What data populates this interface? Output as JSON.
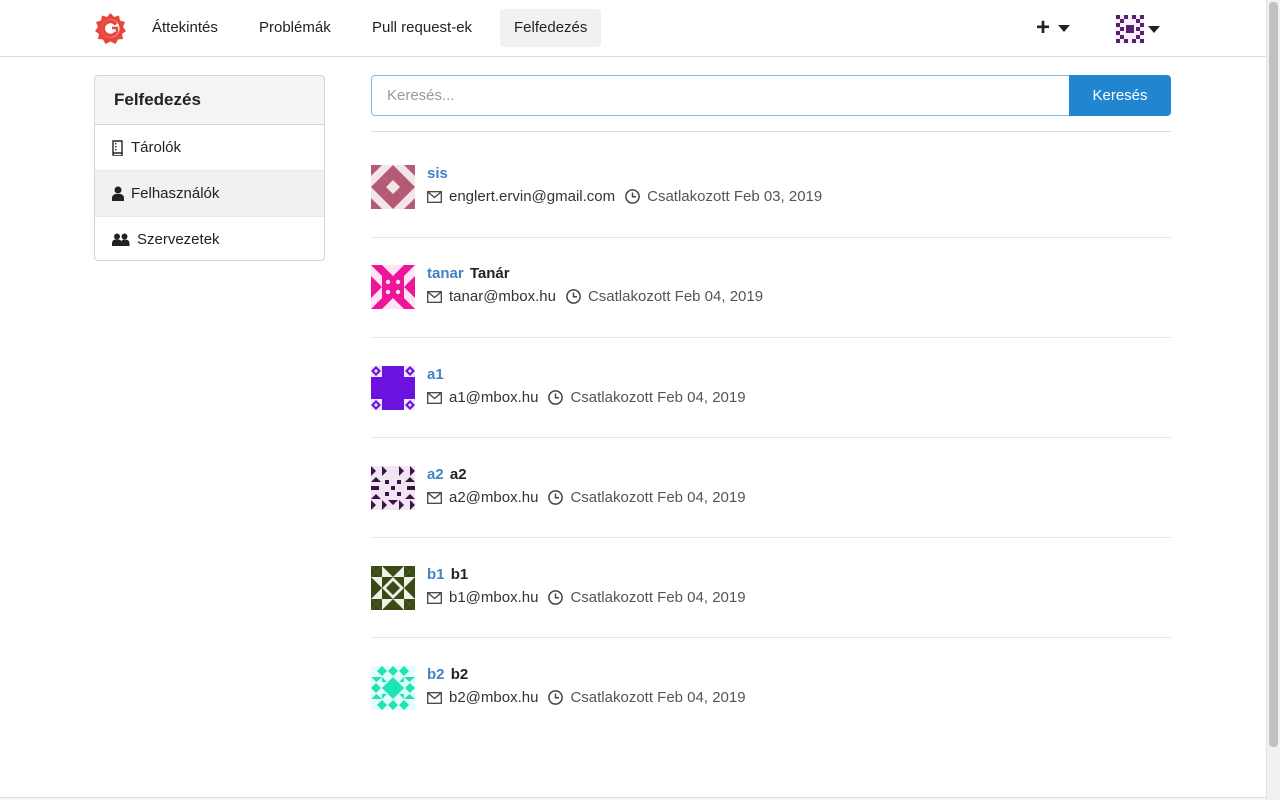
{
  "nav": {
    "items": [
      {
        "label": "Áttekintés"
      },
      {
        "label": "Problémák"
      },
      {
        "label": "Pull request-ek"
      },
      {
        "label": "Felfedezés"
      }
    ],
    "plus_label": "+"
  },
  "sidebar": {
    "title": "Felfedezés",
    "items": [
      {
        "label": "Tárolók",
        "icon": "repo-icon"
      },
      {
        "label": "Felhasználók",
        "icon": "person-icon"
      },
      {
        "label": "Szervezetek",
        "icon": "organization-icon"
      }
    ]
  },
  "search": {
    "placeholder": "Keresés...",
    "button_label": "Keresés"
  },
  "users": [
    {
      "username": "sis",
      "fullname": "",
      "email": "englert.ervin@gmail.com",
      "joined": "Csatlakozott Feb 03, 2019",
      "avatar_color": "#b55a74"
    },
    {
      "username": "tanar",
      "fullname": "Tanár",
      "email": "tanar@mbox.hu",
      "joined": "Csatlakozott Feb 04, 2019",
      "avatar_color": "#ee1599"
    },
    {
      "username": "a1",
      "fullname": "",
      "email": "a1@mbox.hu",
      "joined": "Csatlakozott Feb 04, 2019",
      "avatar_color": "#6c12de"
    },
    {
      "username": "a2",
      "fullname": "a2",
      "email": "a2@mbox.hu",
      "joined": "Csatlakozott Feb 04, 2019",
      "avatar_color": "#3d1246"
    },
    {
      "username": "b1",
      "fullname": "b1",
      "email": "b1@mbox.hu",
      "joined": "Csatlakozott Feb 04, 2019",
      "avatar_color": "#3a4a14"
    },
    {
      "username": "b2",
      "fullname": "b2",
      "email": "b2@mbox.hu",
      "joined": "Csatlakozott Feb 04, 2019",
      "avatar_color": "#1de4b5"
    }
  ],
  "colors": {
    "accent": "#2185d0",
    "link": "#4183c4",
    "logo": "#e8453c"
  }
}
